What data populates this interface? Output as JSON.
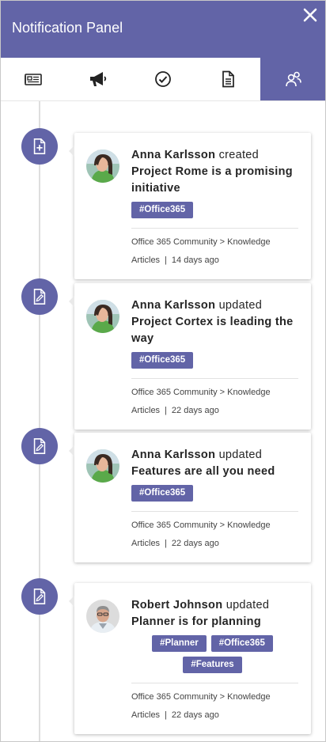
{
  "header": {
    "title": "Notification Panel",
    "close_icon": "close-icon"
  },
  "tabs": [
    {
      "name": "news-icon",
      "active": false
    },
    {
      "name": "megaphone-icon",
      "active": false
    },
    {
      "name": "check-circle-icon",
      "active": false
    },
    {
      "name": "document-icon",
      "active": false
    },
    {
      "name": "people-icon",
      "active": true
    }
  ],
  "colors": {
    "accent": "#6264a7",
    "timeline": "#dedede"
  },
  "items": [
    {
      "icon": "add-document-icon",
      "user": "Anna Karlsson",
      "action": " created ",
      "subject": "Project Rome is a promising initiative",
      "tags": [
        "#Office365"
      ],
      "path": "Office 365 Community > Knowledge Articles",
      "separator": "|",
      "time": "14 days ago"
    },
    {
      "icon": "edit-document-icon",
      "user": "Anna Karlsson",
      "action": " updated ",
      "subject": "Project Cortex is leading the way",
      "tags": [
        "#Office365"
      ],
      "path": "Office 365 Community > Knowledge Articles",
      "separator": "|",
      "time": "22 days ago"
    },
    {
      "icon": "edit-document-icon",
      "user": "Anna Karlsson",
      "action": " updated ",
      "subject": "Features are all you need",
      "tags": [
        "#Office365"
      ],
      "path": "Office 365 Community > Knowledge Articles",
      "separator": "|",
      "time": "22 days ago"
    },
    {
      "icon": "edit-document-icon",
      "user": "Robert Johnson",
      "action": " updated ",
      "subject": "Planner is for planning",
      "tags": [
        "#Planner",
        "#Office365",
        "#Features"
      ],
      "path": "Office 365 Community > Knowledge Articles",
      "separator": "|",
      "time": "22 days ago"
    }
  ]
}
